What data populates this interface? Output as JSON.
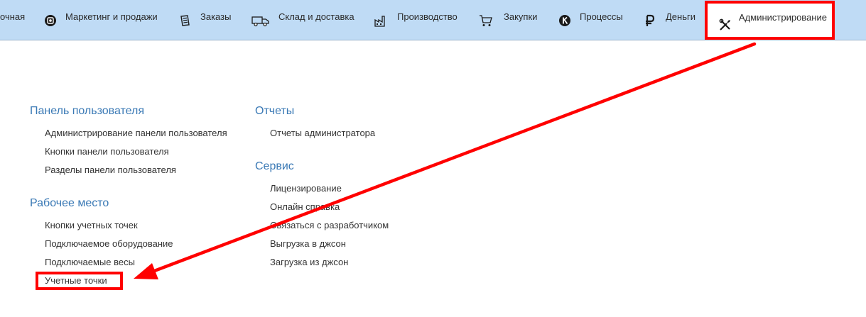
{
  "topnav": {
    "items": [
      {
        "label": "очная",
        "icon": "none"
      },
      {
        "label": "Маркетинг и продажи",
        "icon": "marketing-icon"
      },
      {
        "label": "Заказы",
        "icon": "orders-icon"
      },
      {
        "label": "Склад и доставка",
        "icon": "truck-icon"
      },
      {
        "label": "Производство",
        "icon": "factory-icon"
      },
      {
        "label": "Закупки",
        "icon": "cart-icon"
      },
      {
        "label": "Процессы",
        "icon": "processes-icon"
      },
      {
        "label": "Деньги",
        "icon": "ruble-icon"
      },
      {
        "label": "Администрирование",
        "icon": "tools-icon"
      }
    ]
  },
  "left_column": {
    "panel_title": "Панель пользователя",
    "panel_links": [
      "Администрирование панели пользователя",
      "Кнопки панели пользователя",
      "Разделы панели пользователя"
    ],
    "workplace_title": "Рабочее место",
    "workplace_links": [
      "Кнопки учетных точек",
      "Подключаемое оборудование",
      "Подключаемые весы",
      "Учетные точки"
    ]
  },
  "right_column": {
    "reports_title": "Отчеты",
    "reports_links": [
      "Отчеты администратора"
    ],
    "service_title": "Сервис",
    "service_links": [
      "Лицензирование",
      "Онлайн справка",
      "Связаться с разработчиком",
      "Выгрузка в джсон",
      "Загрузка из джсон"
    ]
  },
  "colors": {
    "topbar_bg": "#bfdbf5",
    "section_title": "#3a79b5",
    "annotation": "#ff0000"
  }
}
